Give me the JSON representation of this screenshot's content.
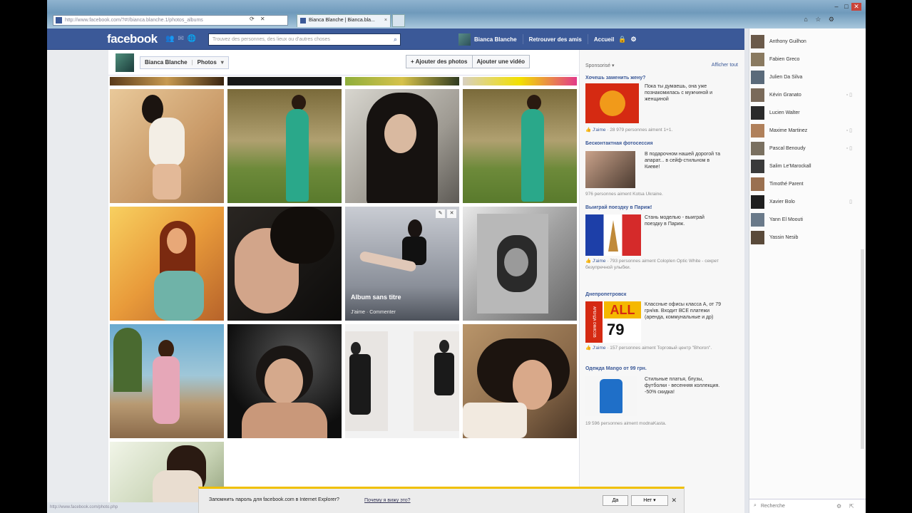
{
  "browser": {
    "address": "http://www.facebook.com/?#!/bianca.blanche.1/photos_albums",
    "tab_title": "Bianca Blanche | Bianca.bla...",
    "tab_close": "×",
    "window_controls": [
      "–",
      "□",
      "✕"
    ],
    "toolbar_icons": [
      "⌂",
      "☆",
      "⚙"
    ]
  },
  "fb": {
    "logo": "facebook",
    "search_placeholder": "Trouvez des personnes, des lieux ou d'autres choses",
    "user_name": "Bianca Blanche",
    "nav_find_friends": "Retrouver des amis",
    "nav_home": "Accueil",
    "icons": [
      "friends-icon",
      "messages-icon",
      "notifications-icon",
      "search-icon",
      "lock-icon",
      "gear-icon"
    ]
  },
  "profile": {
    "name": "Bianca Blanche",
    "section": "Photos",
    "add_photos": "+ Ajouter des photos",
    "add_video": "Ajouter une vidéo"
  },
  "album": {
    "title": "Album sans titre",
    "subtitle": "J'aime · Commenter"
  },
  "ads": {
    "header": "Sponsorisé",
    "see_all": "Afficher tout",
    "items": [
      {
        "title": "Хочешь заменить жену?",
        "desc": "Пока ты думаешь, она уже познакомилась с мужчиной и женщиной",
        "footer_link": "J'aime",
        "footer": " · 28 979 personnes aiment 1+1."
      },
      {
        "title": "Бесконтактная фотосессия",
        "desc": "В подарочном нашей дорогой та апарат... в сейф-стильном в Киеве!",
        "footer_link": "",
        "footer": "976 personnes aiment Kotsa Ukraine."
      },
      {
        "title": "Выиграй поездку в Париж!",
        "desc": "Стань моделью - выиграй поездку в Париж.",
        "footer_link": "J'aime",
        "footer": " · 793 personnes aiment Coloplen Optic White - секрет безупречной улыбки."
      },
      {
        "title": "Днепропетровск",
        "desc": "Классные офисы класса А, от 79 грн/кв. Входит ВСЕ платежи (аренда, коммунальные и др)",
        "footer_link": "J'aime",
        "footer": " · 157 personnes aiment Торговый центр \"Bhoron\".",
        "banner_big": "ALL",
        "banner_num": "79",
        "banner_side": "АРЕНДА ОФИСОВ"
      },
      {
        "title": "Одежда Mango от 99 грн.",
        "desc": "Стильные платья, блузы, футболки - весенняя коллекция. -50% скидка!",
        "footer_link": "",
        "footer": "19 596 personnes aiment modnaKasta."
      }
    ]
  },
  "chat": {
    "friends": [
      {
        "name": "Anthony Guilhon",
        "mobile": ""
      },
      {
        "name": "Fabien Greco",
        "mobile": ""
      },
      {
        "name": "Julien Da Silva",
        "mobile": ""
      },
      {
        "name": "Kévin Granato",
        "mobile": "▫ ▯"
      },
      {
        "name": "Lucien Walter",
        "mobile": ""
      },
      {
        "name": "Maxime Martinez",
        "mobile": "▫ ▯"
      },
      {
        "name": "Pascal Benoudy",
        "mobile": "▫ ▯"
      },
      {
        "name": "Salim Le'Marockall",
        "mobile": ""
      },
      {
        "name": "Timothé Parent",
        "mobile": ""
      },
      {
        "name": "Xavier Bolo",
        "mobile": "▯"
      },
      {
        "name": "Yann El Moouti",
        "mobile": ""
      },
      {
        "name": "Yassin Nesib",
        "mobile": ""
      }
    ],
    "search_placeholder": "Recherche"
  },
  "notification": {
    "message": "Запомнить пароль для facebook.com в Internet Explorer?",
    "why": "Почему я вижу это?",
    "yes": "Да",
    "no": "Нет",
    "close": "✕"
  },
  "status": "http://www.facebook.com/photo.php"
}
